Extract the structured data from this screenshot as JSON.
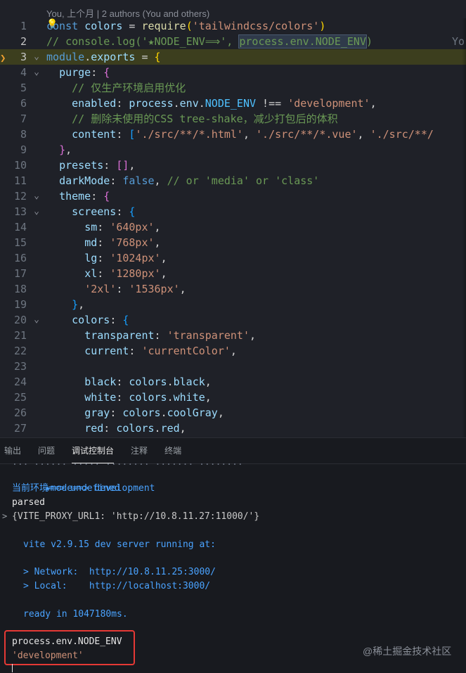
{
  "editor": {
    "blame": "You, 上个月 | 2 authors (You and others)",
    "ghost_blame": "Yo",
    "lines": [
      {
        "n": "1",
        "html": "<span class=\"k\">const</span> <span class=\"v\">colors</span> = <span class=\"f\">require</span><span class=\"b1\">(</span><span class=\"s\">'tailwindcss/colors'</span><span class=\"b1\">)</span>"
      },
      {
        "n": "2",
        "html": "<span class=\"c\">// console.log('★NODE_ENV⟹', <span class=\"boxed\">process.env.NODE_ENV</span>)</span>"
      },
      {
        "n": "3",
        "html": "<span class=\"k\">module</span>.<span class=\"v\">exports</span> = <span class=\"b1\">{</span>"
      },
      {
        "n": "4",
        "html": "  <span class=\"p\">purge</span>: <span class=\"b2\">{</span>"
      },
      {
        "n": "5",
        "html": "    <span class=\"c\">// 仅生产环境启用优化</span>"
      },
      {
        "n": "6",
        "html": "    <span class=\"p\">enabled</span>: <span class=\"v\">process</span>.<span class=\"v\">env</span>.<span class=\"const\">NODE_ENV</span> !== <span class=\"s\">'development'</span>,"
      },
      {
        "n": "7",
        "html": "    <span class=\"c\">// 删除未使用的CSS tree-shake，减少打包后的体积</span>"
      },
      {
        "n": "8",
        "html": "    <span class=\"p\">content</span>: <span class=\"b3\">[</span><span class=\"s\">'./src/**/*.html'</span>, <span class=\"s\">'./src/**/*.vue'</span>, <span class=\"s\">'./src/**/</span>"
      },
      {
        "n": "9",
        "html": "  <span class=\"b2\">}</span>,"
      },
      {
        "n": "10",
        "html": "  <span class=\"p\">presets</span>: <span class=\"b2\">[]</span>,"
      },
      {
        "n": "11",
        "html": "  <span class=\"p\">darkMode</span>: <span class=\"bool\">false</span>, <span class=\"c\">// or 'media' or 'class'</span>"
      },
      {
        "n": "12",
        "html": "  <span class=\"p\">theme</span>: <span class=\"b2\">{</span>"
      },
      {
        "n": "13",
        "html": "    <span class=\"p\">screens</span>: <span class=\"b3\">{</span>"
      },
      {
        "n": "14",
        "html": "      <span class=\"p\">sm</span>: <span class=\"s\">'640px'</span>,"
      },
      {
        "n": "15",
        "html": "      <span class=\"p\">md</span>: <span class=\"s\">'768px'</span>,"
      },
      {
        "n": "16",
        "html": "      <span class=\"p\">lg</span>: <span class=\"s\">'1024px'</span>,"
      },
      {
        "n": "17",
        "html": "      <span class=\"p\">xl</span>: <span class=\"s\">'1280px'</span>,"
      },
      {
        "n": "18",
        "html": "      <span class=\"s\">'2xl'</span>: <span class=\"s\">'1536px'</span>,"
      },
      {
        "n": "19",
        "html": "    <span class=\"b3\">}</span>,"
      },
      {
        "n": "20",
        "html": "    <span class=\"p\">colors</span>: <span class=\"b3\">{</span>"
      },
      {
        "n": "21",
        "html": "      <span class=\"p\">transparent</span>: <span class=\"s\">'transparent'</span>,"
      },
      {
        "n": "22",
        "html": "      <span class=\"p\">current</span>: <span class=\"s\">'currentColor'</span>,"
      },
      {
        "n": "23",
        "html": ""
      },
      {
        "n": "24",
        "html": "      <span class=\"p\">black</span>: <span class=\"v\">colors</span>.<span class=\"v\">black</span>,"
      },
      {
        "n": "25",
        "html": "      <span class=\"p\">white</span>: <span class=\"v\">colors</span>.<span class=\"v\">white</span>,"
      },
      {
        "n": "26",
        "html": "      <span class=\"p\">gray</span>: <span class=\"v\">colors</span>.<span class=\"v\">coolGray</span>,"
      },
      {
        "n": "27",
        "html": "      <span class=\"p\">red</span>: <span class=\"v\">colors</span>.<span class=\"v\">red</span>,"
      }
    ]
  },
  "panel": {
    "tabs": [
      "输出",
      "问题",
      "调试控制台",
      "注释",
      "终端"
    ],
    "active_tab": "调试控制台",
    "console": {
      "cut_line": "... ...... ..... ........ ....... ........",
      "mode_line": "★mode==> development",
      "env_line": "当前环境==> undefined",
      "parsed": "parsed",
      "proxy": "{VITE_PROXY_URL1: 'http://10.8.11.27:11000/'}",
      "vite": "vite v2.9.15 dev server running at:",
      "network": "> Network:  http://10.8.11.25:3000/",
      "local": "> Local:    http://localhost:3000/",
      "ready": "ready in 1047180ms.",
      "expr": "process.env.NODE_ENV",
      "result": "'development'"
    }
  },
  "watermark": "@稀土掘金技术社区"
}
